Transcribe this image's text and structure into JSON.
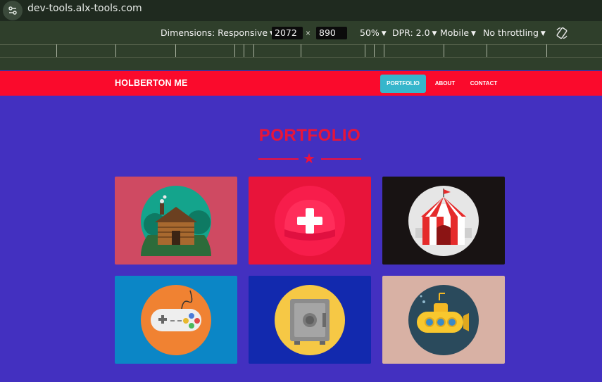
{
  "browser": {
    "url": "dev-tools.alx-tools.com"
  },
  "devtools": {
    "dimensions_label": "Dimensions: Responsive",
    "width": "2072",
    "times": "×",
    "height": "890",
    "zoom": "50%",
    "dpr": "DPR: 2.0",
    "device": "Mobile",
    "throttling": "No throttling"
  },
  "site": {
    "brand": "HOLBERTON ME",
    "nav": [
      {
        "label": "PORTFOLIO",
        "active": true
      },
      {
        "label": "ABOUT",
        "active": false
      },
      {
        "label": "CONTACT",
        "active": false
      }
    ],
    "section_title": "PORTFOLIO",
    "divider_icon": "star-icon"
  },
  "portfolio": [
    {
      "icon": "cabin-icon",
      "bg": "#cf4a62"
    },
    {
      "icon": "cake-icon",
      "bg": "#e8143a"
    },
    {
      "icon": "circus-tent-icon",
      "bg": "#181313"
    },
    {
      "icon": "game-controller-icon",
      "bg": "#0b86c6"
    },
    {
      "icon": "safe-icon",
      "bg": "#1229ae"
    },
    {
      "icon": "submarine-icon",
      "bg": "#d8b1a4"
    }
  ],
  "colors": {
    "brand_red": "#fa0a2c",
    "page_bg": "#4330c0",
    "active_tab": "#36b6cc",
    "title_red": "#e8143a"
  }
}
